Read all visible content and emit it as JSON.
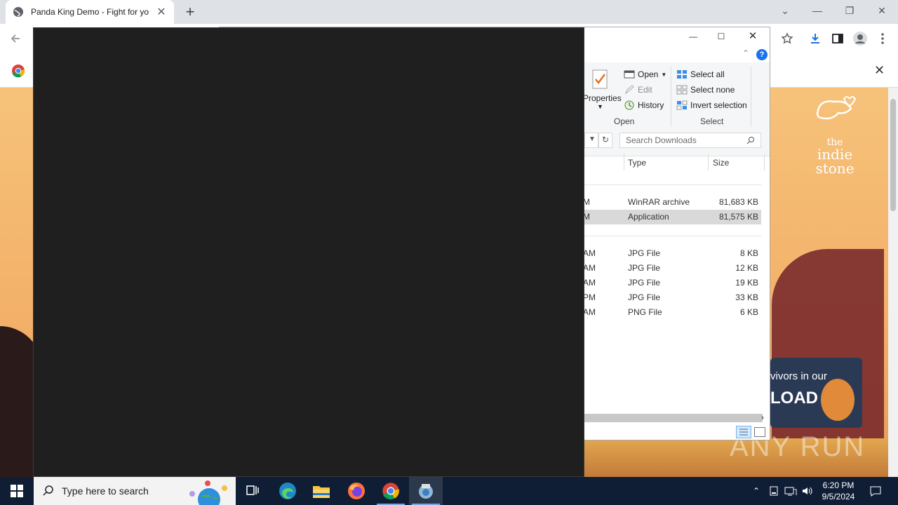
{
  "browser": {
    "tab_title": "Panda King Demo - Fight for yo",
    "new_tab": "+",
    "window_controls": {
      "dropdown": "⌄",
      "minimize": "—",
      "restore": "❐",
      "close": "✕"
    },
    "infobar_close": "✕"
  },
  "page": {
    "brand_line1": "the",
    "brand_line2": "indie stone",
    "ad_line1": "vivors in our",
    "ad_line2": "LOAD",
    "watermark": "ANY RUN"
  },
  "explorer": {
    "controls": {
      "minimize": "—",
      "maximize": "☐",
      "close": "✕"
    },
    "ribbon": {
      "properties": "Properties",
      "open_btn": "Open",
      "edit_btn": "Edit",
      "history_btn": "History",
      "open_group": "Open",
      "select_all": "Select all",
      "select_none": "Select none",
      "invert_selection": "Invert selection",
      "select_group": "Select"
    },
    "search_placeholder": "Search Downloads",
    "columns": {
      "type": "Type",
      "size": "Size"
    },
    "rows": [
      {
        "time": "M",
        "type": "WinRAR archive",
        "size": "81,683 KB",
        "selected": false
      },
      {
        "time": "M",
        "type": "Application",
        "size": "81,575 KB",
        "selected": true
      },
      {
        "time": "AM",
        "type": "JPG File",
        "size": "8 KB",
        "selected": false
      },
      {
        "time": "AM",
        "type": "JPG File",
        "size": "12 KB",
        "selected": false
      },
      {
        "time": "AM",
        "type": "JPG File",
        "size": "19 KB",
        "selected": false
      },
      {
        "time": "PM",
        "type": "JPG File",
        "size": "33 KB",
        "selected": false
      },
      {
        "time": "AM",
        "type": "PNG File",
        "size": "6 KB",
        "selected": false
      }
    ]
  },
  "taskbar": {
    "search_placeholder": "Type here to search",
    "clock_time": "6:20 PM",
    "clock_date": "9/5/2024"
  },
  "colors": {
    "taskbar_bg": "#0f1e35",
    "chrome_tabstrip": "#dee1e6",
    "selection": "#d9d9d9",
    "overlay_black": "#1f1f1f",
    "help_blue": "#1a73e8"
  }
}
